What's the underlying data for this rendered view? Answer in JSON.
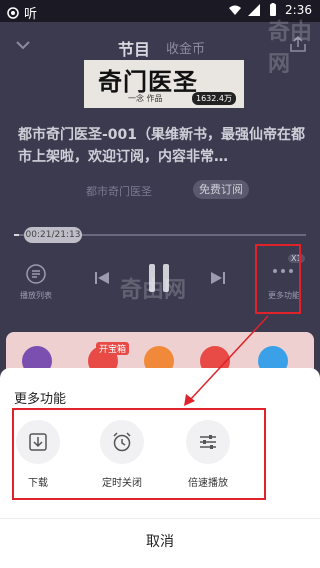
{
  "status": {
    "app_label": "听",
    "time": "2:36"
  },
  "header": {
    "tabs": [
      {
        "label": "节目"
      },
      {
        "label": "收金币"
      }
    ]
  },
  "cover": {
    "title": "奇门医圣",
    "subtitle": "一念 作品",
    "plays": "1632.4万"
  },
  "episode": {
    "title": "都市奇门医圣-001（果维新书，最强仙帝在都市上架啦，欢迎订阅，内容非常…",
    "book_name": "都市奇门医圣",
    "subscribe_label": "免费订阅"
  },
  "progress": {
    "time_label": "00:21/21:13",
    "fraction": 0.017
  },
  "controls": {
    "playlist_label": "播放列表",
    "speed_badge": "X1",
    "more_label": "更多功能"
  },
  "strip": {
    "badge": "开宝箱"
  },
  "sheet": {
    "title": "更多功能",
    "items": [
      {
        "label": "下载"
      },
      {
        "label": "定时关闭"
      },
      {
        "label": "倍速播放"
      }
    ],
    "cancel_label": "取消"
  },
  "watermark": "奇由网",
  "colors": {
    "background": "#3b3a4f",
    "highlight": "#e0222a",
    "sheet": "#ffffff"
  }
}
